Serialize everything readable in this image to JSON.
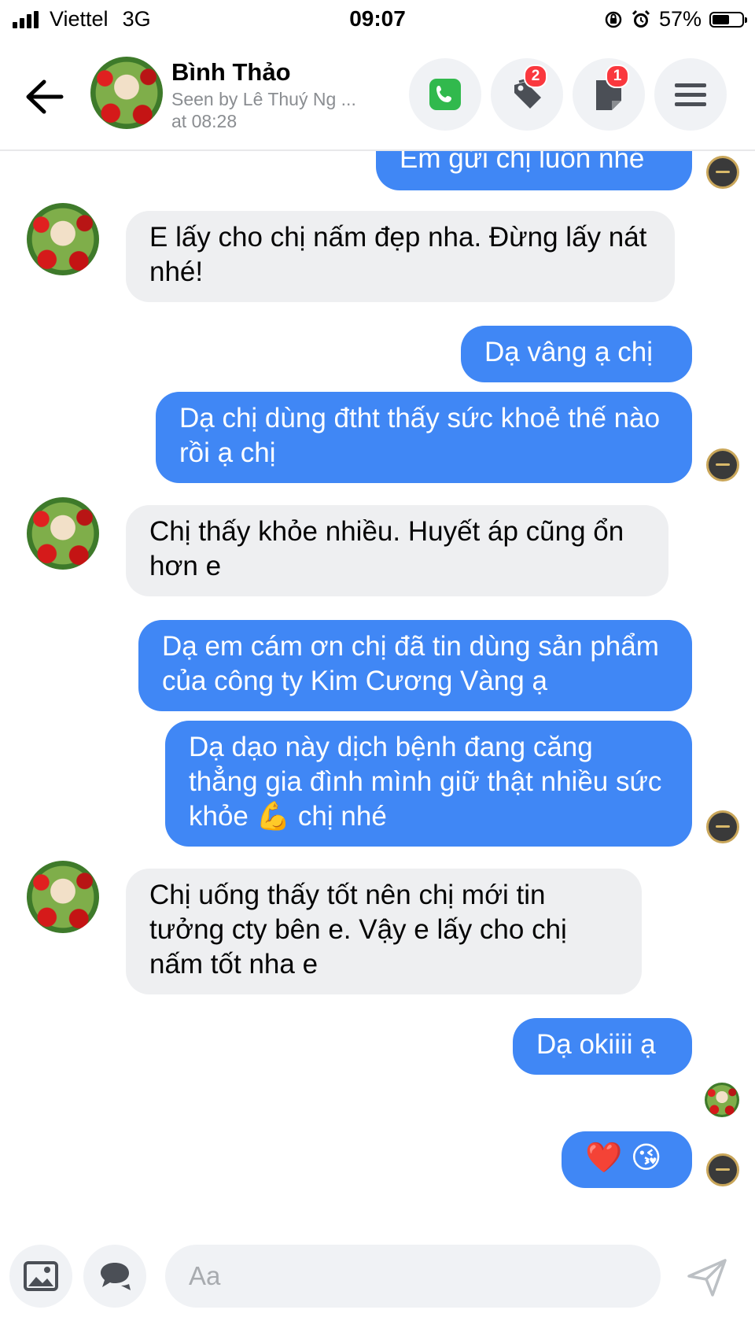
{
  "status_bar": {
    "carrier": "Viettel",
    "network": "3G",
    "time": "09:07",
    "battery": "57%",
    "battery_level": 0.57
  },
  "header": {
    "name": "Bình Thảo",
    "seen_line1": "Seen by Lê Thuý Ng ...",
    "seen_line2": "at 08:28",
    "tags_badge": "2",
    "note_badge": "1",
    "icons": [
      "back-arrow-icon",
      "phone-icon",
      "tag-icon",
      "note-icon",
      "menu-icon"
    ],
    "phone_color": "#31b94d"
  },
  "messages": [
    {
      "from": "me",
      "text": "Em gửi chị luôn nhé"
    },
    {
      "from": "them",
      "text": "E lấy cho chị nấm đẹp nha. Đừng lấy nát nhé!"
    },
    {
      "from": "me",
      "text": "Dạ vâng ạ chị"
    },
    {
      "from": "me",
      "text": "Dạ chị dùng đtht thấy sức khoẻ thế nào rồi ạ chị"
    },
    {
      "from": "them",
      "text": "Chị thấy khỏe nhiều. Huyết áp cũng ổn hơn e"
    },
    {
      "from": "me",
      "text": "Dạ em cám ơn chị đã tin dùng sản phẩm của công ty Kim Cương Vàng ạ"
    },
    {
      "from": "me",
      "text": "Dạ dạo này dịch bệnh đang căng thẳng gia đình mình giữ thật nhiều sức khỏe 💪 chị nhé"
    },
    {
      "from": "them",
      "text": "Chị uống thấy tốt nên chị mới tin tưởng cty bên e. Vậy e lấy cho chị nấm tốt nha e"
    },
    {
      "from": "me",
      "text": "Dạ okiiii ạ"
    },
    {
      "from": "me",
      "text": "❤️ 😘"
    }
  ],
  "composer": {
    "placeholder": "Aa",
    "icons": [
      "image-icon",
      "sticker-icon",
      "send-icon"
    ]
  },
  "colors": {
    "outgoing_bubble": "#4087f5",
    "incoming_bubble": "#eeeff1",
    "badge": "#fa383e"
  }
}
